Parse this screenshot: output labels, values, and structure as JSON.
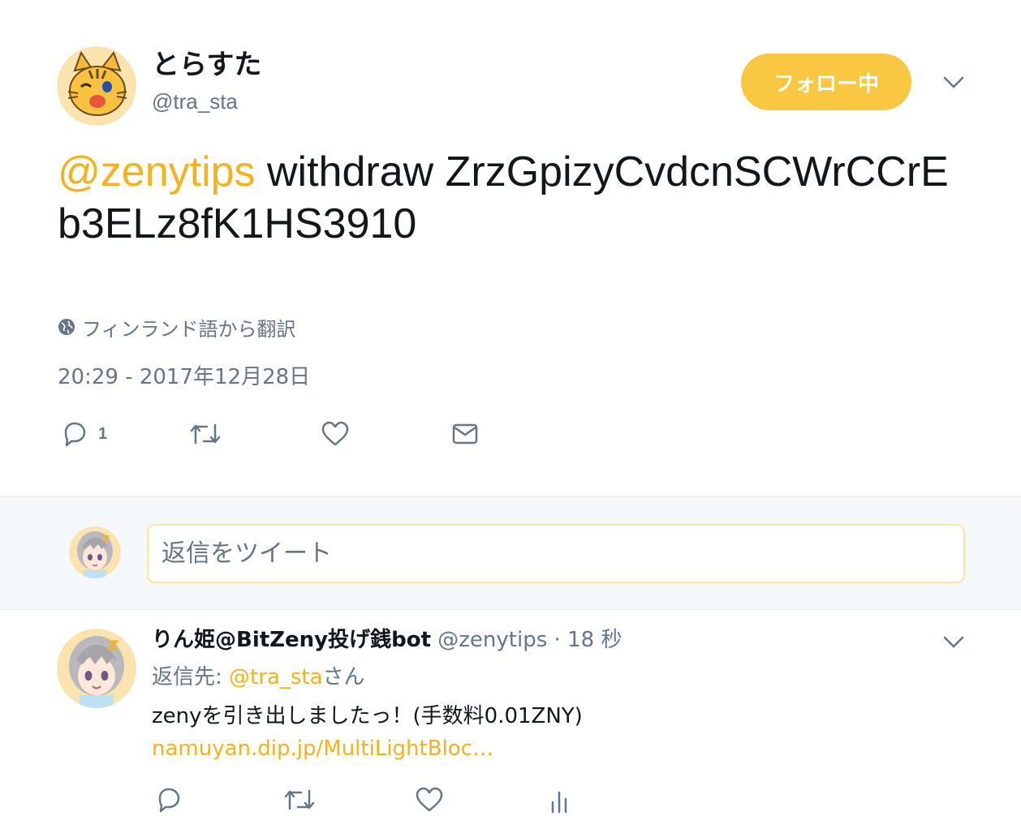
{
  "tweet": {
    "author_name": "とらすた",
    "author_handle": "@tra_sta",
    "follow_label": "フォロー中",
    "mention": "@zenytips",
    "text_rest": " withdraw ZrzGpizyCvdcnSCWrCCrEb3ELz8fK1HS3910",
    "translate_label": "フィンランド語から翻訳",
    "timestamp": "20:29 - 2017年12月28日",
    "reply_count": "1"
  },
  "reply_box": {
    "placeholder": "返信をツイート"
  },
  "reply": {
    "name": "りん姫@BitZeny投げ銭bot",
    "handle": "@zenytips",
    "separator": "·",
    "time": "18 秒",
    "reply_to_prefix": "返信先: ",
    "reply_to_mention": "@tra_sta",
    "reply_to_suffix": "さん",
    "body": "zenyを引き出しましたっ！(手数料0.01ZNY)",
    "link": "namuyan.dip.jp/MultiLightBloc…"
  },
  "icons": {
    "globe": "globe-icon",
    "reply": "reply-icon",
    "retweet": "retweet-icon",
    "like": "like-icon",
    "dm": "direct-message-icon",
    "analytics": "analytics-icon",
    "chevron": "chevron-down-icon"
  },
  "colors": {
    "accent": "#fac743",
    "link": "#f4b31e",
    "secondary_text": "#657786",
    "primary_text": "#14171a"
  }
}
